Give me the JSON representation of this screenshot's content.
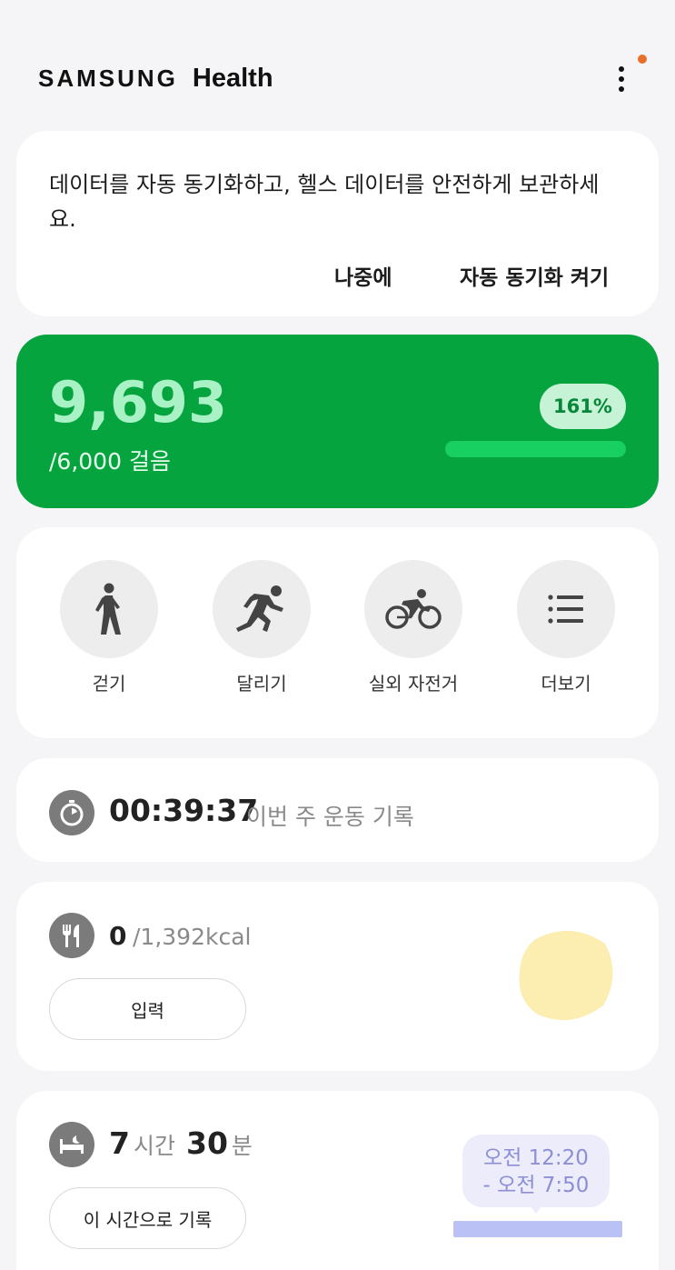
{
  "header": {
    "brand": "SAMSUNG",
    "product": "Health",
    "more_icon": "more-vert-icon",
    "notification_color": "#e8702a"
  },
  "sync_card": {
    "message": "데이터를 자동 동기화하고, 헬스 데이터를 안전하게 보관하세요.",
    "later_label": "나중에",
    "enable_label": "자동 동기화 켜기"
  },
  "steps": {
    "count": "9,693",
    "goal": "/6,000 걸음",
    "percent": "161%",
    "progress": 1.0,
    "card_color": "#06a43f",
    "bar_color": "#18cf62"
  },
  "shortcuts": [
    {
      "label": "걷기",
      "icon": "walking-icon"
    },
    {
      "label": "달리기",
      "icon": "running-icon"
    },
    {
      "label": "실외 자전거",
      "icon": "cycling-icon"
    },
    {
      "label": "더보기",
      "icon": "list-icon"
    }
  ],
  "exercise": {
    "icon": "stopwatch-icon",
    "time": "00:39:37",
    "label": "이번 주 운동 기록"
  },
  "food": {
    "icon": "fork-knife-icon",
    "value": "0",
    "goal": "/1,392kcal",
    "button_label": "입력",
    "illustration": "lemon-icon"
  },
  "sleep": {
    "icon": "bed-icon",
    "hours": "7",
    "hours_unit": "시간",
    "minutes": "30",
    "minutes_unit": "분",
    "button_label": "이 시간으로 기록",
    "range_start": "오전 12:20",
    "range_end": "- 오전 7:50"
  }
}
